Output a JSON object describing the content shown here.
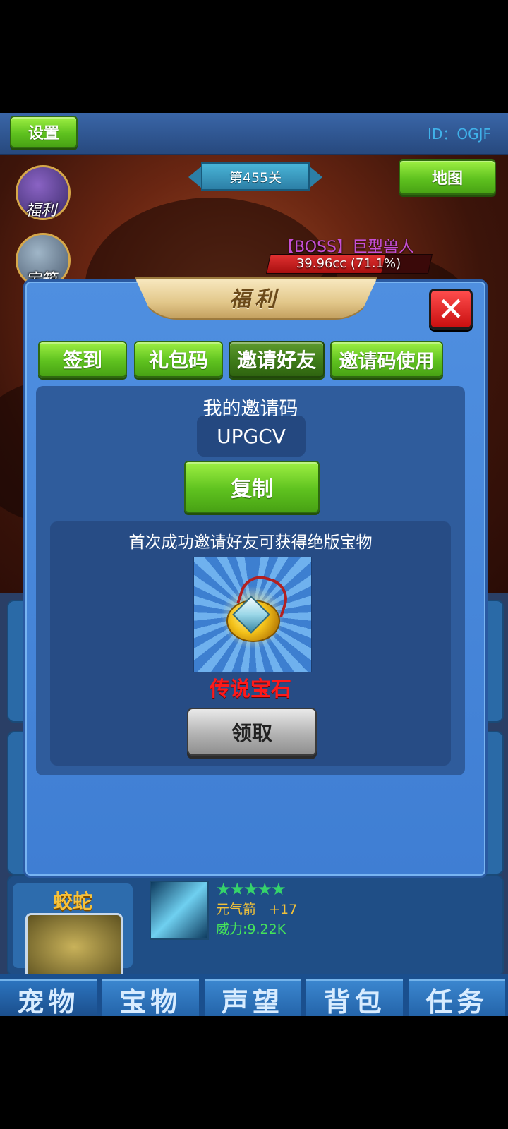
{
  "topbar": {
    "settings_label": "设置",
    "player_id": "ID：OGJF"
  },
  "stage": {
    "level_label": "第455关",
    "map_label": "地图"
  },
  "side_menu": {
    "welfare_label": "福利",
    "chest_label": "宝箱"
  },
  "boss": {
    "name": "【BOSS】巨型兽人",
    "hp_text": "39.96cc (71.1%)",
    "hp_fraction": 0.711
  },
  "modal": {
    "title": "福利",
    "tabs": [
      {
        "label": "签到"
      },
      {
        "label": "礼包码"
      },
      {
        "label": "邀请好友",
        "selected": true
      },
      {
        "label": "邀请码使用"
      }
    ],
    "invite": {
      "label": "我的邀请码",
      "code": "UPGCV",
      "copy_label": "复制",
      "reward_text": "首次成功邀请好友可获得绝版宝物",
      "reward_item": "传说宝石",
      "claim_label": "领取"
    }
  },
  "pet": {
    "name": "蛟蛇"
  },
  "skill": {
    "stars": "★★★★★",
    "name": "元气箭",
    "level": "+17",
    "power": "威力:9.22K"
  },
  "bottom_nav": [
    {
      "label": "宠物"
    },
    {
      "label": "宝物"
    },
    {
      "label": "声望"
    },
    {
      "label": "背包"
    },
    {
      "label": "任务"
    }
  ]
}
